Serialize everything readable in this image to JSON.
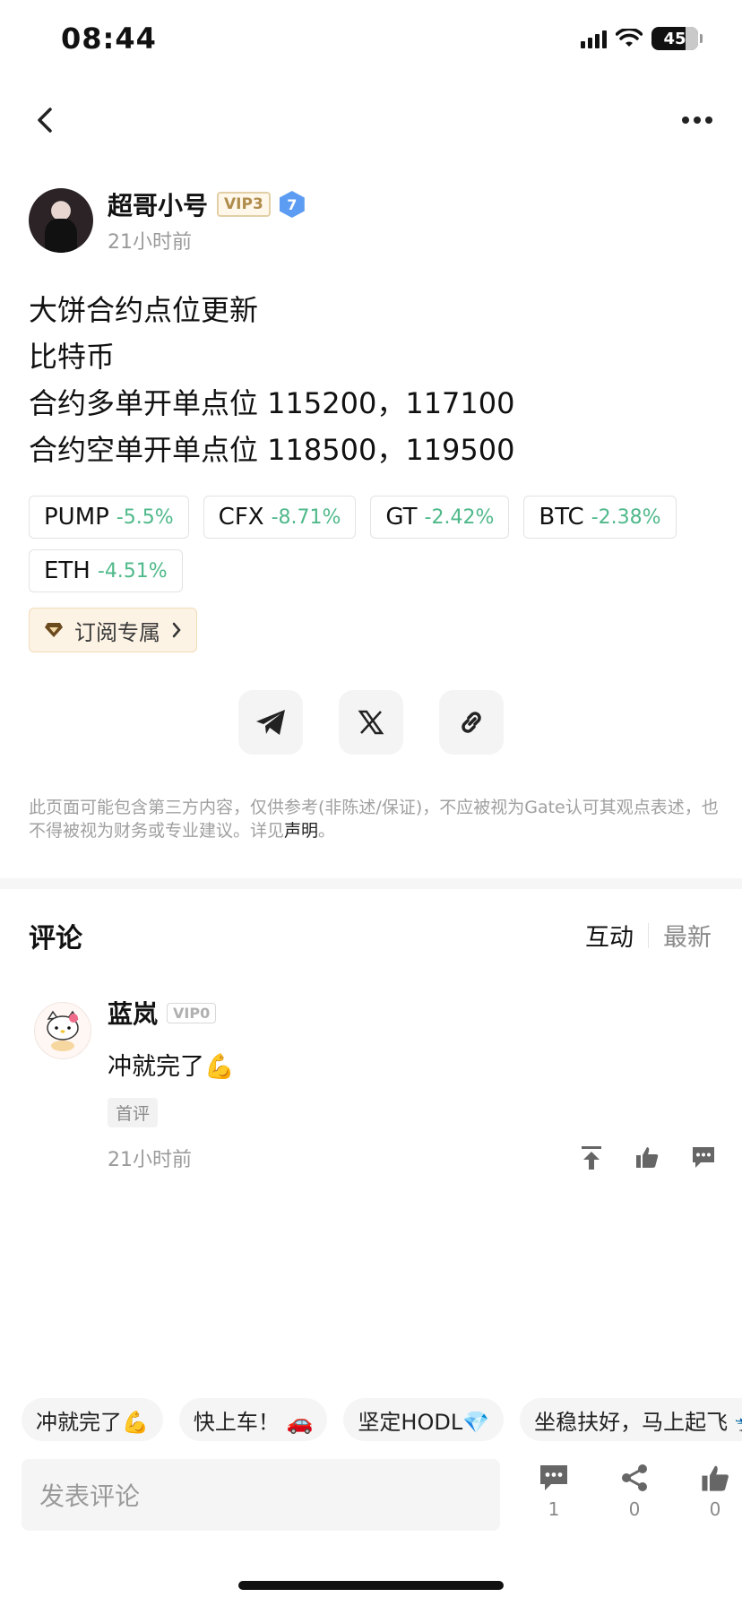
{
  "status_bar": {
    "time": "08:44",
    "battery": "45"
  },
  "author": {
    "name": "超哥小号",
    "vip": "VIP3",
    "level": "7",
    "time": "21小时前"
  },
  "post": {
    "lines": [
      "大饼合约点位更新",
      "比特币",
      "合约多单开单点位 115200，117100",
      "合约空单开单点位 118500，119500"
    ]
  },
  "tags": [
    {
      "symbol": "PUMP",
      "change": "-5.5%"
    },
    {
      "symbol": "CFX",
      "change": "-8.71%"
    },
    {
      "symbol": "GT",
      "change": "-2.42%"
    },
    {
      "symbol": "BTC",
      "change": "-2.38%"
    },
    {
      "symbol": "ETH",
      "change": "-4.51%"
    }
  ],
  "subscribe": {
    "label": "订阅专属"
  },
  "share": {
    "icons": [
      "telegram-icon",
      "x-icon",
      "link-icon"
    ]
  },
  "disclaimer": {
    "text": "此页面可能包含第三方内容，仅供参考(非陈述/保证)，不应被视为Gate认可其观点表述，也不得被视为财务或专业建议。详见",
    "link": "声明",
    "end": "。"
  },
  "comments": {
    "title": "评论",
    "sort_active": "互动",
    "sort_inactive": "最新",
    "items": [
      {
        "name": "蓝岚",
        "vip": "VIP0",
        "text": "冲就完了💪",
        "badge": "首评",
        "time": "21小时前"
      }
    ]
  },
  "quick_replies": [
    "冲就完了💪",
    "快上车！ 🚗",
    "坚定HODL💎",
    "坐稳扶好，马上起飞 🛫"
  ],
  "bottom_bar": {
    "placeholder": "发表评论",
    "comment_count": "1",
    "share_count": "0",
    "like_count": "0"
  },
  "colors": {
    "up_down_green": "#4fb98a",
    "vip_gold": "#b08d4c",
    "level_blue": "#5c9cf2"
  }
}
